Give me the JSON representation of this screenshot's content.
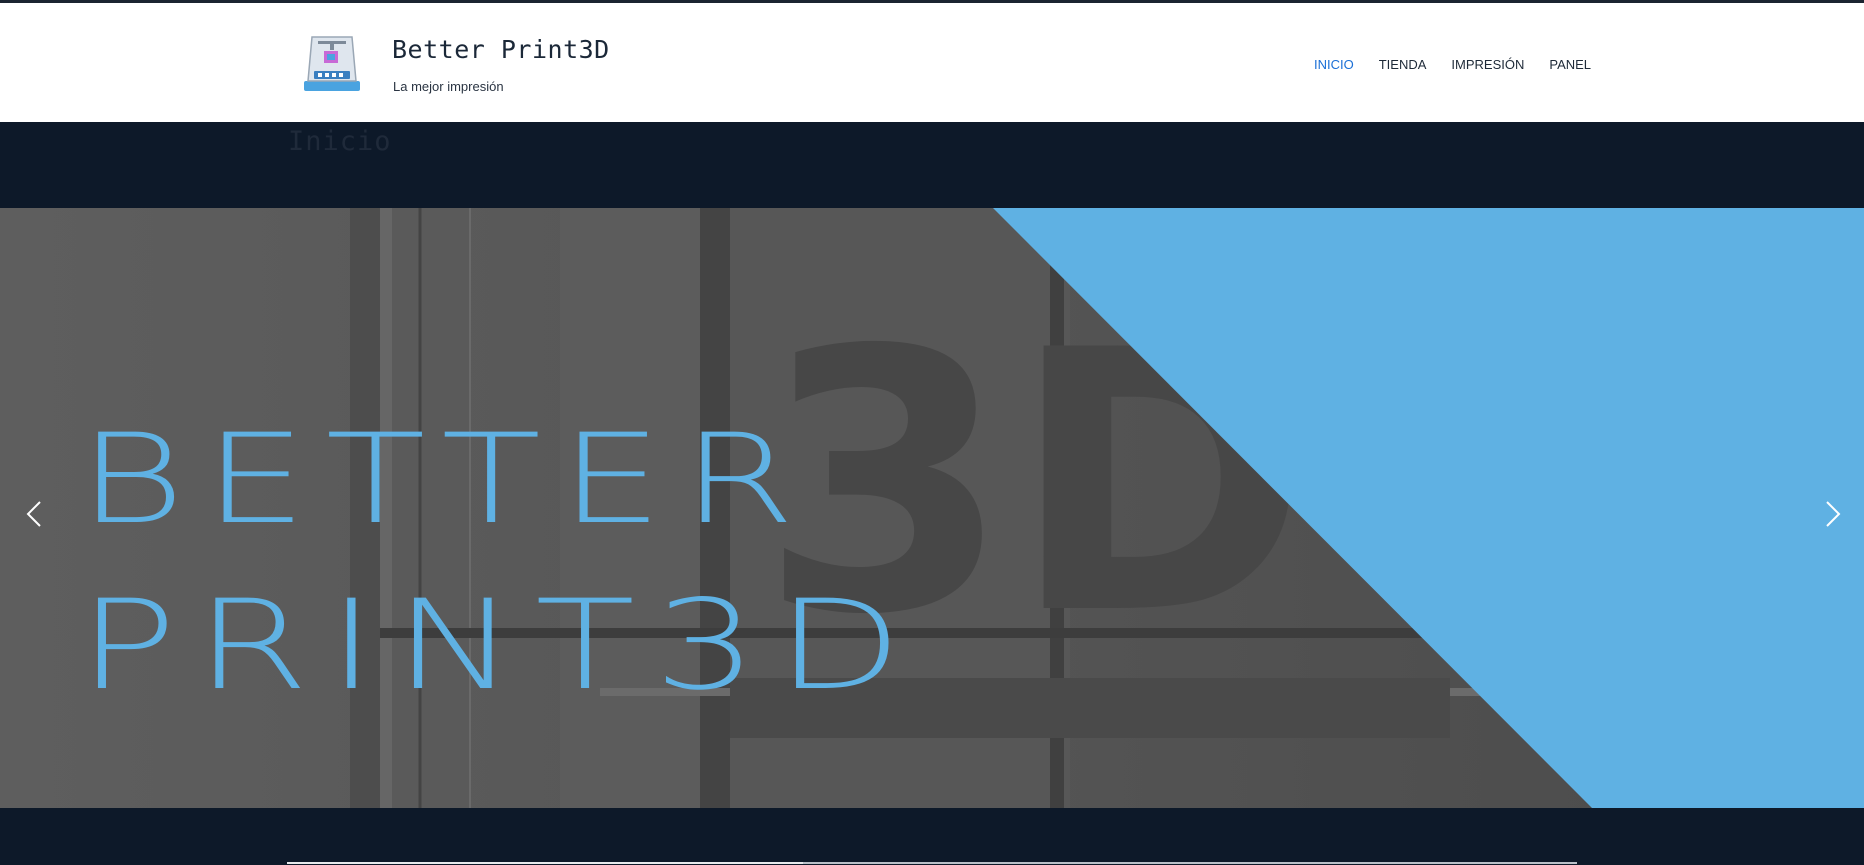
{
  "site": {
    "title": "Better Print3D",
    "tagline": "La mejor impresión"
  },
  "nav": {
    "items": [
      {
        "label": "INICIO",
        "active": true
      },
      {
        "label": "TIENDA",
        "active": false
      },
      {
        "label": "IMPRESIÓN",
        "active": false
      },
      {
        "label": "PANEL",
        "active": false
      }
    ]
  },
  "page": {
    "heading": "Inicio"
  },
  "slider": {
    "line1": "BETTER",
    "line2": "PRINT3D",
    "background_text": "3D",
    "prev_icon": "chevron-left-icon",
    "next_icon": "chevron-right-icon"
  },
  "colors": {
    "accent": "#1a6fd6",
    "brand_blue": "#5fb1e3",
    "dark_band": "#0d1929"
  }
}
